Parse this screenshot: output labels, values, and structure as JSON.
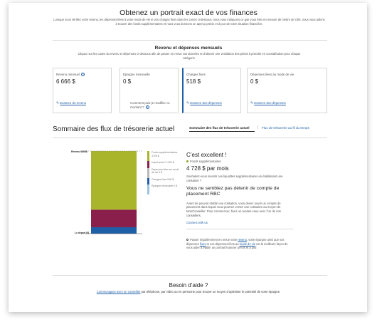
{
  "header": {
    "title": "Obtenez un portrait exact de vos finances",
    "intro": "Lorsque vous vérifiez votre revenu, les dépenses liées à votre mode de vie et vos charges fixes dans les zones ci-dessous, nous vous indiquons ce que vous êtes en mesure de mettre de côté, nous vous aidons à trouver des fonds supplémentaires et nous vous donnons un aperçu précis et à jour de votre situation financière."
  },
  "income_section": {
    "title": "Revenu et dépenses mensuels",
    "intro": "Cliquez sur les cases du revenu et dépenses ci-dessous afin de passer en revue vos données et d’obtenir une ventilation des points à prendre en considération pour chaque catégorie.",
    "boxes": [
      {
        "label": "Revenu mensuel",
        "value": "6 666 $",
        "link": "Examen du revenu"
      },
      {
        "label": "Épargne mensuelle",
        "value": "0 $",
        "question": "Comment puis-je modifier ce montant ?"
      },
      {
        "label": "Charges fixes",
        "value": "518 $",
        "link": "Examen des dépenses"
      },
      {
        "label": "Dépenses liées au mode de vie",
        "value": "0 $",
        "link": "Examen des dépenses"
      }
    ]
  },
  "cashflow": {
    "title": "Sommaire des flux de trésorerie actuel",
    "tabs": [
      "Sommaire des flux de trésorerie actuel",
      "Flux de trésorerie au fil du temps"
    ],
    "axis_top": "Revenu 6666$",
    "axis_bottom": "Le départ 0$",
    "legend": [
      {
        "label": "Fonds supplémentaires 4728 $",
        "color": "#a9b52a"
      },
      {
        "label": "Impôt prévu* 1420 $",
        "color": "#8a1f4b"
      },
      {
        "label": "Dépenses liées au mode de vie 0 $",
        "color": "#b9b9b9"
      },
      {
        "label": "Charges fixes 518 $",
        "color": "#1f5fa8"
      },
      {
        "label": "Épargne mensuelle 0 $",
        "color": "#9dc3e0"
      }
    ]
  },
  "chart_data": {
    "type": "bar",
    "stacked": true,
    "categories": [
      ""
    ],
    "series": [
      {
        "name": "Charges fixes",
        "values": [
          518
        ]
      },
      {
        "name": "Impôt prévu*",
        "values": [
          1420
        ]
      },
      {
        "name": "Fonds supplémentaires",
        "values": [
          4728
        ]
      }
    ],
    "ylim": [
      0,
      6666
    ]
  },
  "result": {
    "title": "C’est excellent !",
    "sub_label": "Fonds supplémentaires",
    "amount": "4 728 $ par mois",
    "text": "Souhaitez-vous investir ces liquidités supplémentaires en établissant une cotisation ?",
    "heading": "Vous ne semblez pas détenir de compte de placement RBC",
    "paragraph": "Avant de pouvoir établir une cotisation, vous devez ouvrir un compte de placement dans lequel vous pourrez verser une cotisation au moyen de MonConseiller. Pour commencer, fixez un rendez-vous avec l’un de nos conseillers.",
    "link": "Connect with us",
    "foot_1": "Passer régulièrement en revue votre ",
    "foot_link_1": "revenu",
    "foot_2": ", votre épargne ainsi que vos dépenses ",
    "foot_link_2": "fixes",
    "foot_3": " et vos dépenses liées au ",
    "foot_link_3": "mode de vie",
    "foot_4": " est la meilleure façon de vous aider à établir un portrait financier précis et à jour."
  },
  "help": {
    "title": "Besoin d’aide ?",
    "link": "Communiquez avec un conseiller",
    "text": " par téléphone, par vidéo ou en personne pour trouver un moyen d’optimiser le potentiel de votre épargne."
  }
}
